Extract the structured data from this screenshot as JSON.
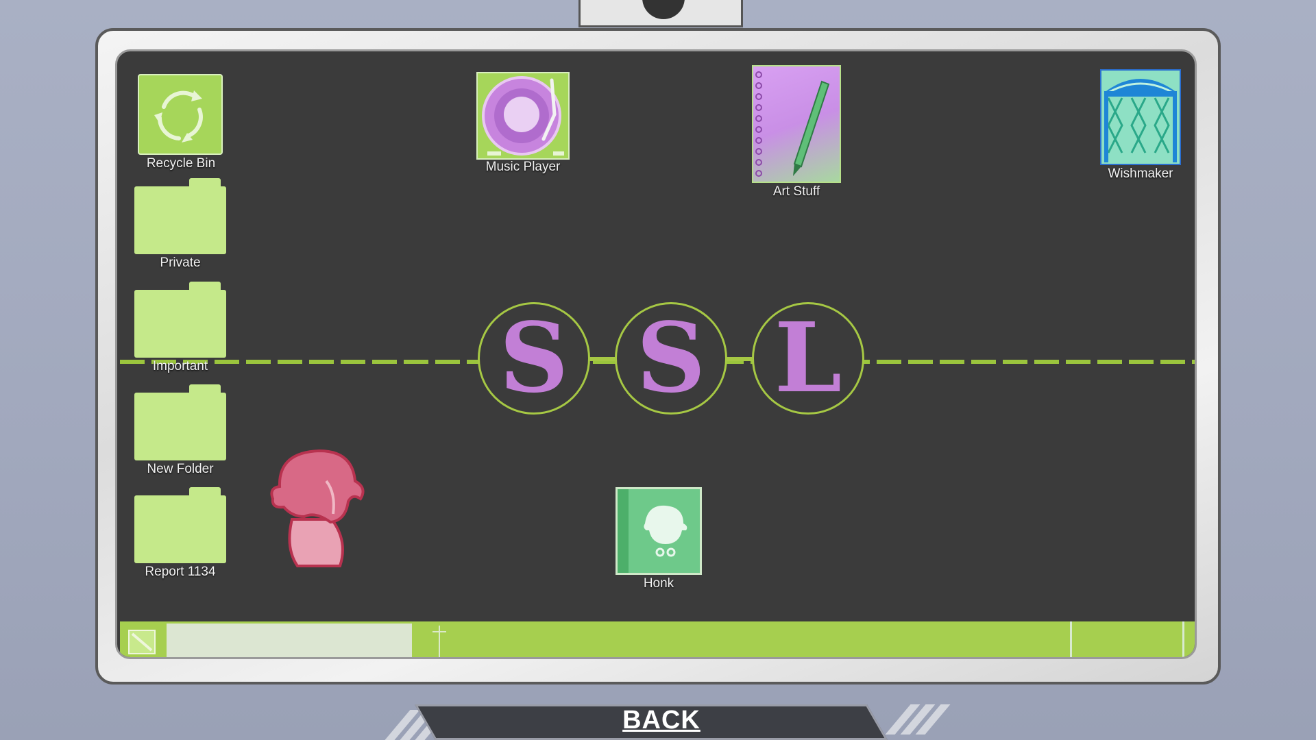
{
  "desktop": {
    "icons": [
      {
        "label": "Recycle Bin"
      },
      {
        "label": "Private"
      },
      {
        "label": "Important"
      },
      {
        "label": "New Folder"
      },
      {
        "label": "Report 1134"
      },
      {
        "label": "Music Player"
      },
      {
        "label": "Art Stuff"
      },
      {
        "label": "Wishmaker"
      },
      {
        "label": "Honk"
      }
    ],
    "wallpaper_logo": [
      "S",
      "S",
      "L"
    ]
  },
  "back_button": {
    "label": "BACK"
  },
  "colors": {
    "accent_green": "#a6cf4f",
    "folder_green": "#c5e98a",
    "logo_purple": "#c27fd6",
    "desktop_bg": "#3b3b3b"
  }
}
